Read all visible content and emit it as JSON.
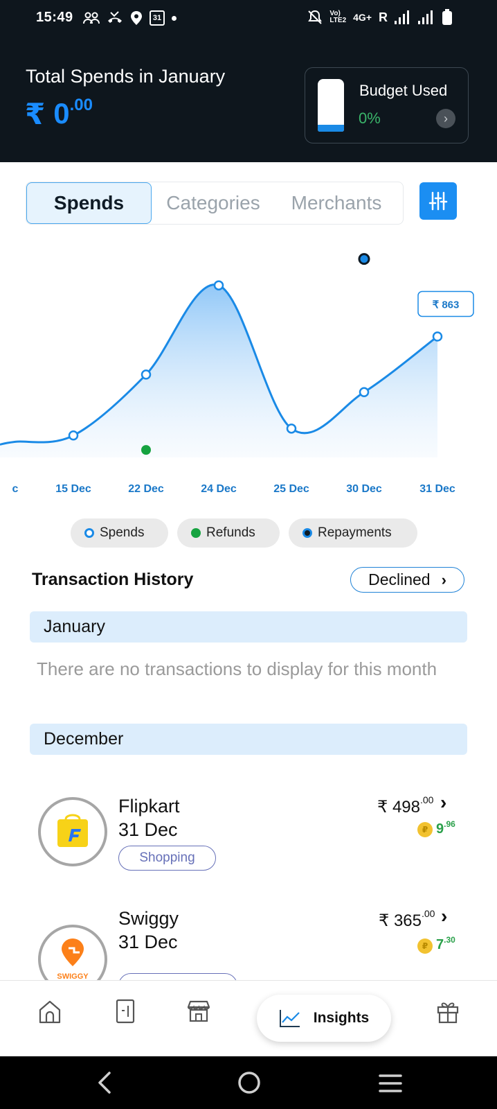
{
  "status_bar": {
    "time": "15:49",
    "network": "4G+",
    "roaming": "R",
    "left_icons": [
      "people-icon",
      "missed-call-icon",
      "location-icon",
      "calendar-icon"
    ],
    "calendar_badge": "31",
    "right_icons": [
      "mute-icon",
      "volte-icon",
      "signal-icon",
      "signal-icon",
      "battery-icon"
    ]
  },
  "header": {
    "title": "Total Spends in January",
    "currency": "₹",
    "amount_int": "0",
    "amount_dec": ".00",
    "budget": {
      "title": "Budget Used",
      "percent": "0%",
      "used_fraction": 0.0
    }
  },
  "tabs": [
    {
      "label": "Spends",
      "active": true
    },
    {
      "label": "Categories",
      "active": false
    },
    {
      "label": "Merchants",
      "active": false
    }
  ],
  "chart_data": {
    "type": "line",
    "categories": [
      "c",
      "15 Dec",
      "22 Dec",
      "24 Dec",
      "25 Dec",
      "30 Dec",
      "31 Dec"
    ],
    "series": [
      {
        "name": "Spends",
        "values": [
          25,
          75,
          560,
          1270,
          130,
          420,
          863
        ],
        "color": "#1a8ae6"
      },
      {
        "name": "Refunds",
        "values": [
          null,
          null,
          -40,
          null,
          null,
          null,
          null
        ],
        "color": "#16a340"
      },
      {
        "name": "Repayments",
        "values": [
          null,
          null,
          null,
          null,
          null,
          1480,
          null
        ],
        "color": "#1a8ae6"
      }
    ],
    "tooltip": {
      "category": "31 Dec",
      "label": "₹ 863"
    },
    "ylim": [
      -100,
      1500
    ],
    "grid": false,
    "legend_position": "bottom"
  },
  "legend": [
    {
      "label": "Spends",
      "color": "#ffffff",
      "ring": "#1a8ae6"
    },
    {
      "label": "Refunds",
      "color": "#16a340",
      "ring": "#16a340"
    },
    {
      "label": "Repayments",
      "color": "#0e1a24",
      "ring": "#1a8ae6"
    }
  ],
  "transactions": {
    "title": "Transaction History",
    "declined_label": "Declined",
    "months": [
      {
        "name": "January",
        "empty_text": "There are no transactions to display for this month"
      },
      {
        "name": "December"
      }
    ],
    "items": [
      {
        "merchant": "Flipkart",
        "date": "31 Dec",
        "category": "Shopping",
        "amount_int": "₹ 498",
        "amount_dec": ".00",
        "points_int": "9",
        "points_dec": ".96",
        "coin": "₽"
      },
      {
        "merchant": "Swiggy",
        "logo_text": "SWIGGY",
        "date": "31 Dec",
        "category": "",
        "amount_int": "₹ 365",
        "amount_dec": ".00",
        "points_int": "7",
        "points_dec": ".30",
        "coin": "₽"
      }
    ]
  },
  "bottom_nav": {
    "items": [
      "home-icon",
      "card-icon",
      "store-icon",
      "insights-icon",
      "gift-icon"
    ],
    "active_label": "Insights"
  },
  "system_nav": [
    "back",
    "home",
    "recents"
  ]
}
